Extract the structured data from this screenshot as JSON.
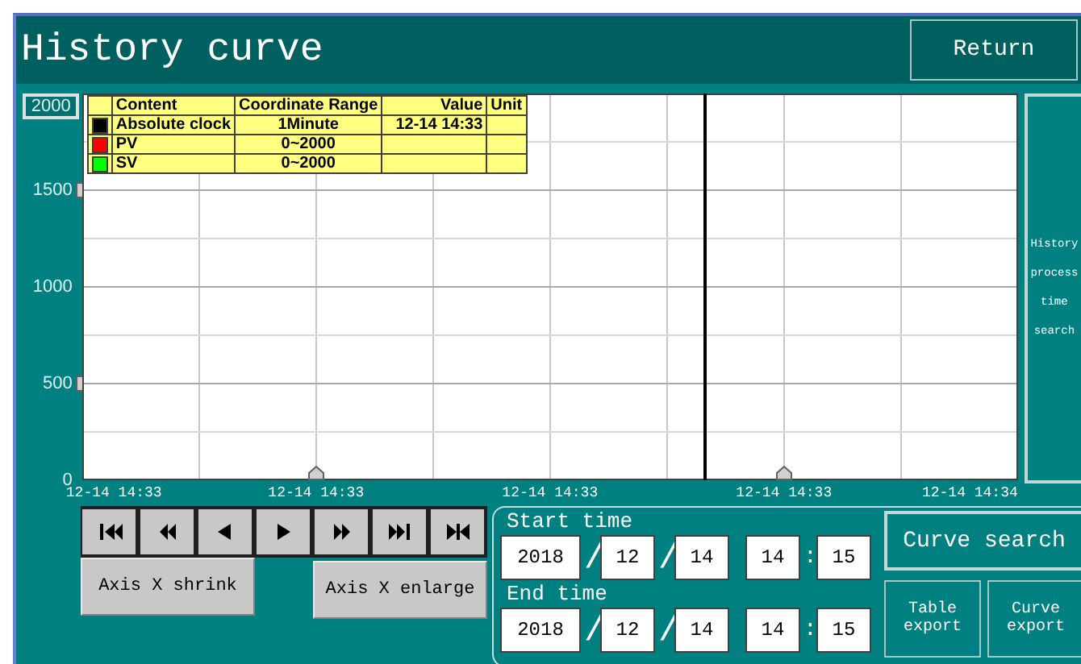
{
  "window": {
    "title": "History curve"
  },
  "return_button": "Return",
  "chart": {
    "y_axis_labels": [
      {
        "text": "2000",
        "kind": "field",
        "marker": false
      },
      {
        "text": "1500",
        "kind": "label",
        "marker": true
      },
      {
        "text": "1000",
        "kind": "label",
        "marker": false
      },
      {
        "text": "500",
        "kind": "label",
        "marker": true
      },
      {
        "text": "0",
        "kind": "label",
        "marker": false
      }
    ],
    "x_axis_labels": [
      {
        "text": "12-14 14:33",
        "marker": false
      },
      {
        "text": "12-14 14:33",
        "marker": true
      },
      {
        "text": "12-14 14:33",
        "marker": false
      },
      {
        "text": "12-14 14:33",
        "marker": true
      },
      {
        "text": "12-14 14:34",
        "marker": false
      }
    ],
    "cursor": {
      "level": 0.665
    },
    "legend": {
      "columns": [
        "Content",
        "Coordinate Range",
        "Value",
        "Unit"
      ],
      "rows": [
        {
          "color": "#000000",
          "content": "Absolute clock",
          "range": "1Minute",
          "value": "12-14 14:33"
        },
        {
          "color": "#ff0000",
          "content": "PV",
          "range": "0~2000"
        },
        {
          "color": "#00ff00",
          "content": "SV",
          "range": "0~2000"
        }
      ]
    }
  },
  "side_button": [
    "History",
    "process",
    "time",
    "search"
  ],
  "nav_buttons": [
    {
      "kind": "first"
    },
    {
      "kind": "rewind"
    },
    {
      "kind": "back"
    },
    {
      "kind": "forward"
    },
    {
      "kind": "fast"
    },
    {
      "kind": "last"
    },
    {
      "kind": "center"
    }
  ],
  "axis_buttons": [
    "Axis X shrink",
    "Axis X enlarge"
  ],
  "start_time": {
    "label": "Start time",
    "year": "2018",
    "month": "12",
    "day": "14",
    "hour": "14",
    "minute": "15"
  },
  "end_time": {
    "label": "End time",
    "year": "2018",
    "month": "12",
    "day": "14",
    "hour": "14",
    "minute": "15"
  },
  "date_separator": "/",
  "time_separator": ":",
  "curve_search_button": "Curve search",
  "export_buttons": [
    [
      "Table",
      "export"
    ],
    [
      "Curve",
      "export"
    ]
  ]
}
